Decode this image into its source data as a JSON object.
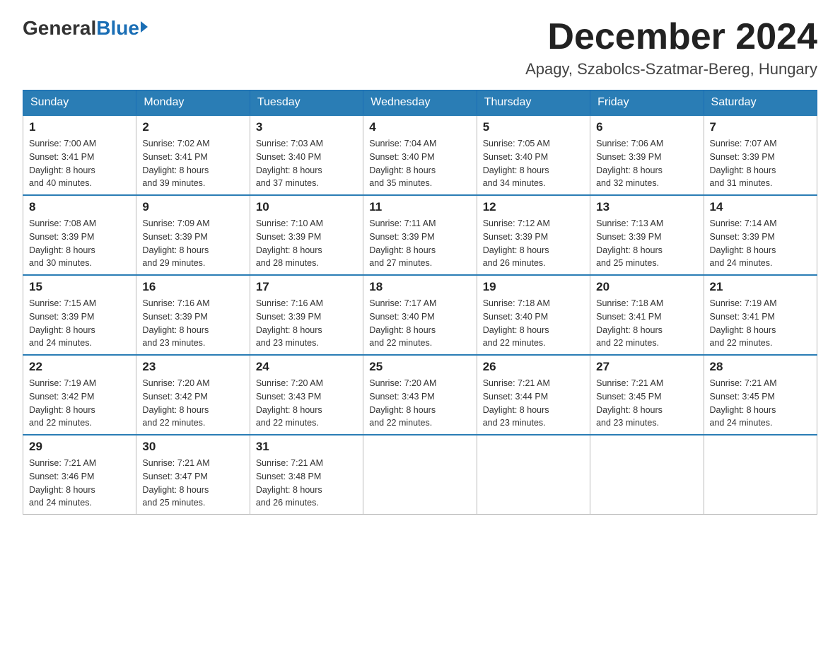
{
  "header": {
    "logo_general": "General",
    "logo_blue": "Blue",
    "month_title": "December 2024",
    "location": "Apagy, Szabolcs-Szatmar-Bereg, Hungary"
  },
  "weekdays": [
    "Sunday",
    "Monday",
    "Tuesday",
    "Wednesday",
    "Thursday",
    "Friday",
    "Saturday"
  ],
  "weeks": [
    [
      {
        "day": "1",
        "sunrise": "Sunrise: 7:00 AM",
        "sunset": "Sunset: 3:41 PM",
        "daylight": "Daylight: 8 hours",
        "daylight2": "and 40 minutes."
      },
      {
        "day": "2",
        "sunrise": "Sunrise: 7:02 AM",
        "sunset": "Sunset: 3:41 PM",
        "daylight": "Daylight: 8 hours",
        "daylight2": "and 39 minutes."
      },
      {
        "day": "3",
        "sunrise": "Sunrise: 7:03 AM",
        "sunset": "Sunset: 3:40 PM",
        "daylight": "Daylight: 8 hours",
        "daylight2": "and 37 minutes."
      },
      {
        "day": "4",
        "sunrise": "Sunrise: 7:04 AM",
        "sunset": "Sunset: 3:40 PM",
        "daylight": "Daylight: 8 hours",
        "daylight2": "and 35 minutes."
      },
      {
        "day": "5",
        "sunrise": "Sunrise: 7:05 AM",
        "sunset": "Sunset: 3:40 PM",
        "daylight": "Daylight: 8 hours",
        "daylight2": "and 34 minutes."
      },
      {
        "day": "6",
        "sunrise": "Sunrise: 7:06 AM",
        "sunset": "Sunset: 3:39 PM",
        "daylight": "Daylight: 8 hours",
        "daylight2": "and 32 minutes."
      },
      {
        "day": "7",
        "sunrise": "Sunrise: 7:07 AM",
        "sunset": "Sunset: 3:39 PM",
        "daylight": "Daylight: 8 hours",
        "daylight2": "and 31 minutes."
      }
    ],
    [
      {
        "day": "8",
        "sunrise": "Sunrise: 7:08 AM",
        "sunset": "Sunset: 3:39 PM",
        "daylight": "Daylight: 8 hours",
        "daylight2": "and 30 minutes."
      },
      {
        "day": "9",
        "sunrise": "Sunrise: 7:09 AM",
        "sunset": "Sunset: 3:39 PM",
        "daylight": "Daylight: 8 hours",
        "daylight2": "and 29 minutes."
      },
      {
        "day": "10",
        "sunrise": "Sunrise: 7:10 AM",
        "sunset": "Sunset: 3:39 PM",
        "daylight": "Daylight: 8 hours",
        "daylight2": "and 28 minutes."
      },
      {
        "day": "11",
        "sunrise": "Sunrise: 7:11 AM",
        "sunset": "Sunset: 3:39 PM",
        "daylight": "Daylight: 8 hours",
        "daylight2": "and 27 minutes."
      },
      {
        "day": "12",
        "sunrise": "Sunrise: 7:12 AM",
        "sunset": "Sunset: 3:39 PM",
        "daylight": "Daylight: 8 hours",
        "daylight2": "and 26 minutes."
      },
      {
        "day": "13",
        "sunrise": "Sunrise: 7:13 AM",
        "sunset": "Sunset: 3:39 PM",
        "daylight": "Daylight: 8 hours",
        "daylight2": "and 25 minutes."
      },
      {
        "day": "14",
        "sunrise": "Sunrise: 7:14 AM",
        "sunset": "Sunset: 3:39 PM",
        "daylight": "Daylight: 8 hours",
        "daylight2": "and 24 minutes."
      }
    ],
    [
      {
        "day": "15",
        "sunrise": "Sunrise: 7:15 AM",
        "sunset": "Sunset: 3:39 PM",
        "daylight": "Daylight: 8 hours",
        "daylight2": "and 24 minutes."
      },
      {
        "day": "16",
        "sunrise": "Sunrise: 7:16 AM",
        "sunset": "Sunset: 3:39 PM",
        "daylight": "Daylight: 8 hours",
        "daylight2": "and 23 minutes."
      },
      {
        "day": "17",
        "sunrise": "Sunrise: 7:16 AM",
        "sunset": "Sunset: 3:39 PM",
        "daylight": "Daylight: 8 hours",
        "daylight2": "and 23 minutes."
      },
      {
        "day": "18",
        "sunrise": "Sunrise: 7:17 AM",
        "sunset": "Sunset: 3:40 PM",
        "daylight": "Daylight: 8 hours",
        "daylight2": "and 22 minutes."
      },
      {
        "day": "19",
        "sunrise": "Sunrise: 7:18 AM",
        "sunset": "Sunset: 3:40 PM",
        "daylight": "Daylight: 8 hours",
        "daylight2": "and 22 minutes."
      },
      {
        "day": "20",
        "sunrise": "Sunrise: 7:18 AM",
        "sunset": "Sunset: 3:41 PM",
        "daylight": "Daylight: 8 hours",
        "daylight2": "and 22 minutes."
      },
      {
        "day": "21",
        "sunrise": "Sunrise: 7:19 AM",
        "sunset": "Sunset: 3:41 PM",
        "daylight": "Daylight: 8 hours",
        "daylight2": "and 22 minutes."
      }
    ],
    [
      {
        "day": "22",
        "sunrise": "Sunrise: 7:19 AM",
        "sunset": "Sunset: 3:42 PM",
        "daylight": "Daylight: 8 hours",
        "daylight2": "and 22 minutes."
      },
      {
        "day": "23",
        "sunrise": "Sunrise: 7:20 AM",
        "sunset": "Sunset: 3:42 PM",
        "daylight": "Daylight: 8 hours",
        "daylight2": "and 22 minutes."
      },
      {
        "day": "24",
        "sunrise": "Sunrise: 7:20 AM",
        "sunset": "Sunset: 3:43 PM",
        "daylight": "Daylight: 8 hours",
        "daylight2": "and 22 minutes."
      },
      {
        "day": "25",
        "sunrise": "Sunrise: 7:20 AM",
        "sunset": "Sunset: 3:43 PM",
        "daylight": "Daylight: 8 hours",
        "daylight2": "and 22 minutes."
      },
      {
        "day": "26",
        "sunrise": "Sunrise: 7:21 AM",
        "sunset": "Sunset: 3:44 PM",
        "daylight": "Daylight: 8 hours",
        "daylight2": "and 23 minutes."
      },
      {
        "day": "27",
        "sunrise": "Sunrise: 7:21 AM",
        "sunset": "Sunset: 3:45 PM",
        "daylight": "Daylight: 8 hours",
        "daylight2": "and 23 minutes."
      },
      {
        "day": "28",
        "sunrise": "Sunrise: 7:21 AM",
        "sunset": "Sunset: 3:45 PM",
        "daylight": "Daylight: 8 hours",
        "daylight2": "and 24 minutes."
      }
    ],
    [
      {
        "day": "29",
        "sunrise": "Sunrise: 7:21 AM",
        "sunset": "Sunset: 3:46 PM",
        "daylight": "Daylight: 8 hours",
        "daylight2": "and 24 minutes."
      },
      {
        "day": "30",
        "sunrise": "Sunrise: 7:21 AM",
        "sunset": "Sunset: 3:47 PM",
        "daylight": "Daylight: 8 hours",
        "daylight2": "and 25 minutes."
      },
      {
        "day": "31",
        "sunrise": "Sunrise: 7:21 AM",
        "sunset": "Sunset: 3:48 PM",
        "daylight": "Daylight: 8 hours",
        "daylight2": "and 26 minutes."
      },
      null,
      null,
      null,
      null
    ]
  ]
}
